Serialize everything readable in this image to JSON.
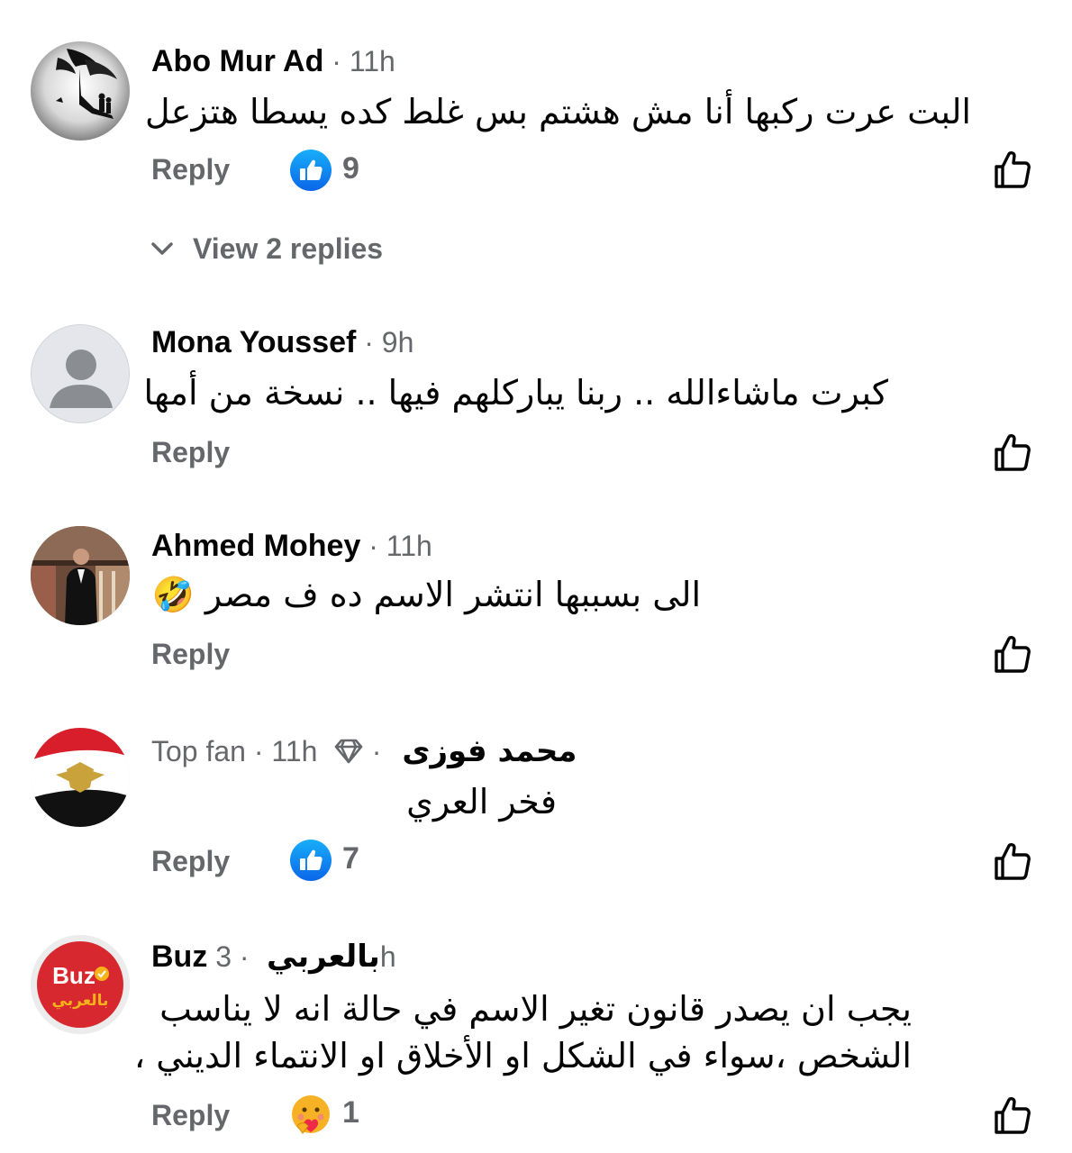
{
  "comments": [
    {
      "name": "Abo Mur Ad",
      "meta": " · 11h",
      "text": "البت عرت ركبها أنا مش هشتم بس غلط كده يسطا هتزعل",
      "reply_label": "Reply",
      "reaction_icon": "like-reaction-icon",
      "reaction_count": "9",
      "view_replies_label": "View 2 replies"
    },
    {
      "name": "Mona Youssef",
      "meta": " · 9h",
      "text": "كبرت ماشاءالله .. ربنا يباركلهم فيها .. نسخة من أمها",
      "reply_label": "Reply"
    },
    {
      "name": "Ahmed Mohey",
      "meta": " · 11h",
      "text": "الى بسببها انتشر الاسم ده ف مصر",
      "emoji": "🤣",
      "reply_label": "Reply"
    },
    {
      "name": "محمد فوزى",
      "meta_prefix": "Top fan · 11h",
      "meta_sep": " · ",
      "text": "فخر العري",
      "reply_label": "Reply",
      "reaction_icon": "like-reaction-icon",
      "reaction_count": "7"
    },
    {
      "name_part1": "Buz",
      "meta_part1": " 3",
      "name_part2": "بالعربي",
      "meta_part2": " ·",
      "meta_part3": "h",
      "text_line1": "يجب ان يصدر قانون تغير الاسم في حالة انه لا يناسب",
      "text_line2": "الشخص ،سواء في الشكل او الأخلاق او الانتماء الديني ،",
      "reply_label": "Reply",
      "reaction_icon": "care-reaction-icon",
      "reaction_count": "1",
      "avatar_text_1": "Buz",
      "avatar_text_2": "بالعربي"
    }
  ],
  "colors": {
    "facebook_blue": "#1877f2",
    "meta_gray": "#65676b",
    "text": "#050505"
  }
}
